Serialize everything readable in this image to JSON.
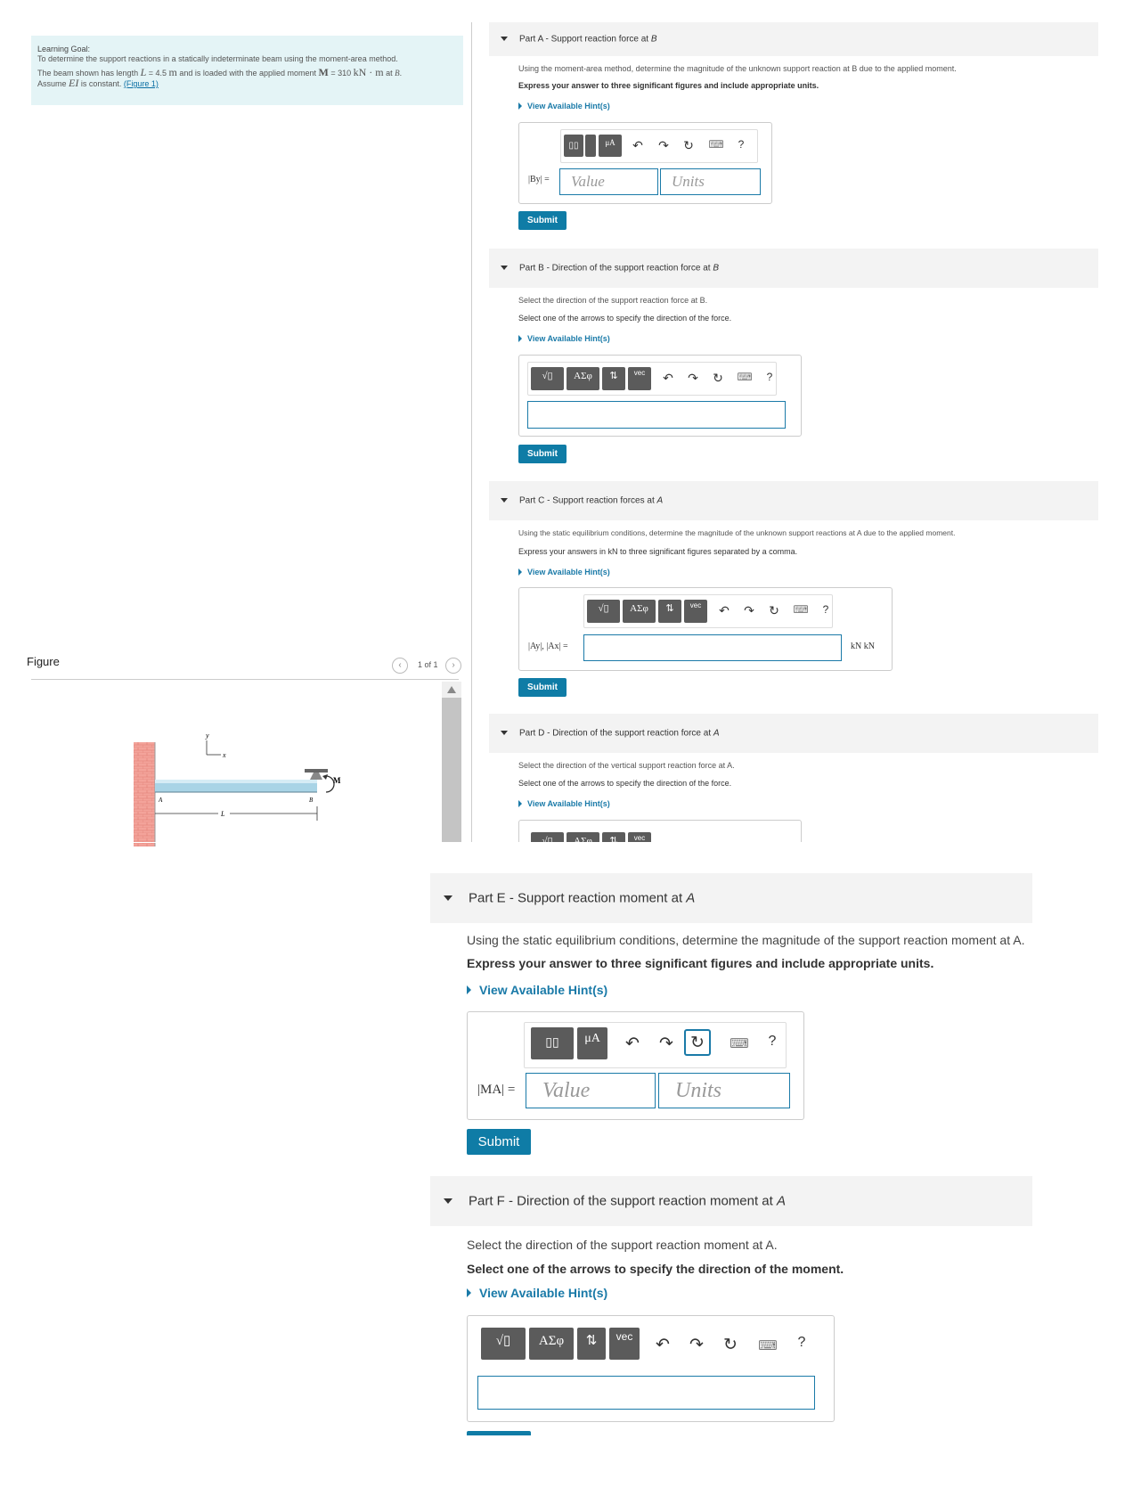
{
  "goal": {
    "heading": "Learning Goal:",
    "line1": "To determine the support reactions in a statically indeterminate beam using the moment-area method.",
    "line2_pre": "The beam shown has length ",
    "L_sym": "L",
    "line2_eq1": " = 4.5 ",
    "unit_m": "m",
    "line2_mid": " and is loaded with the applied moment ",
    "M_sym": "M",
    "line2_eq2": " = 310 ",
    "unit_knm": "kN · m",
    "line2_end": " at ",
    "B_sym": "B",
    "line2_period": ".",
    "line3_pre": "Assume ",
    "EI_sym": "EI",
    "line3_post": " is constant. ",
    "figure_link": "(Figure 1)"
  },
  "figure": {
    "title": "Figure",
    "pager": "1 of 1",
    "label_y": "y",
    "label_x": "x",
    "label_A": "A",
    "label_B": "B",
    "label_M": "M",
    "label_L": "L"
  },
  "partA": {
    "title_pre": "Part A - Support reaction force at ",
    "title_var": "B",
    "q1": "Using the moment-area method, determine the magnitude of the unknown support reaction at B due to the applied moment.",
    "q2": "Express your answer to three significant figures and include appropriate units.",
    "hint": "View Available Hint(s)",
    "var_label": "|By| =",
    "value_ph": "Value",
    "units_ph": "Units",
    "submit": "Submit"
  },
  "partB": {
    "title_pre": "Part B - Direction of the support reaction force at ",
    "title_var": "B",
    "q1": "Select the direction of the support reaction force at B.",
    "q2": "Select one of the arrows to specify the direction of the force.",
    "hint": "View Available Hint(s)",
    "submit": "Submit"
  },
  "partC": {
    "title_pre": "Part C - Support reaction forces at ",
    "title_var": "A",
    "q1": "Using the static equilibrium conditions, determine the magnitude of the unknown support reactions at A due to the applied moment.",
    "q2": "Express your answers in kN to three significant figures separated by a comma.",
    "hint": "View Available Hint(s)",
    "var_label": "|Ay|, |Ax| =",
    "unit_suffix": "kN kN",
    "submit": "Submit"
  },
  "partD": {
    "title_pre": "Part D - Direction of the support reaction force at ",
    "title_var": "A",
    "q1": "Select the direction of the vertical support reaction force at A.",
    "q2": "Select one of the arrows to specify the direction of the force.",
    "hint": "View Available Hint(s)"
  },
  "partE": {
    "title_pre": "Part E - Support reaction moment at ",
    "title_var": "A",
    "q1": "Using the static equilibrium conditions, determine the magnitude of the support reaction moment at A.",
    "q2": "Express your answer to three significant figures and include appropriate units.",
    "hint": "View Available Hint(s)",
    "var_label": "|MA| =",
    "value_ph": "Value",
    "units_ph": "Units",
    "submit": "Submit"
  },
  "partF": {
    "title_pre": "Part F - Direction of the support reaction moment at ",
    "title_var": "A",
    "q1": "Select the direction of the support reaction moment at A.",
    "q2": "Select one of the arrows to specify the direction of the moment.",
    "hint": "View Available Hint(s)"
  },
  "toolbar": {
    "templates": "▯▯",
    "mu_a": "μA",
    "sqrt": "√▯",
    "greek": "ΑΣφ",
    "arrows": "⇅",
    "vec": "vec",
    "undo": "↶",
    "redo": "↷",
    "reset": "↻",
    "keyboard": "⌨",
    "help": "?"
  }
}
